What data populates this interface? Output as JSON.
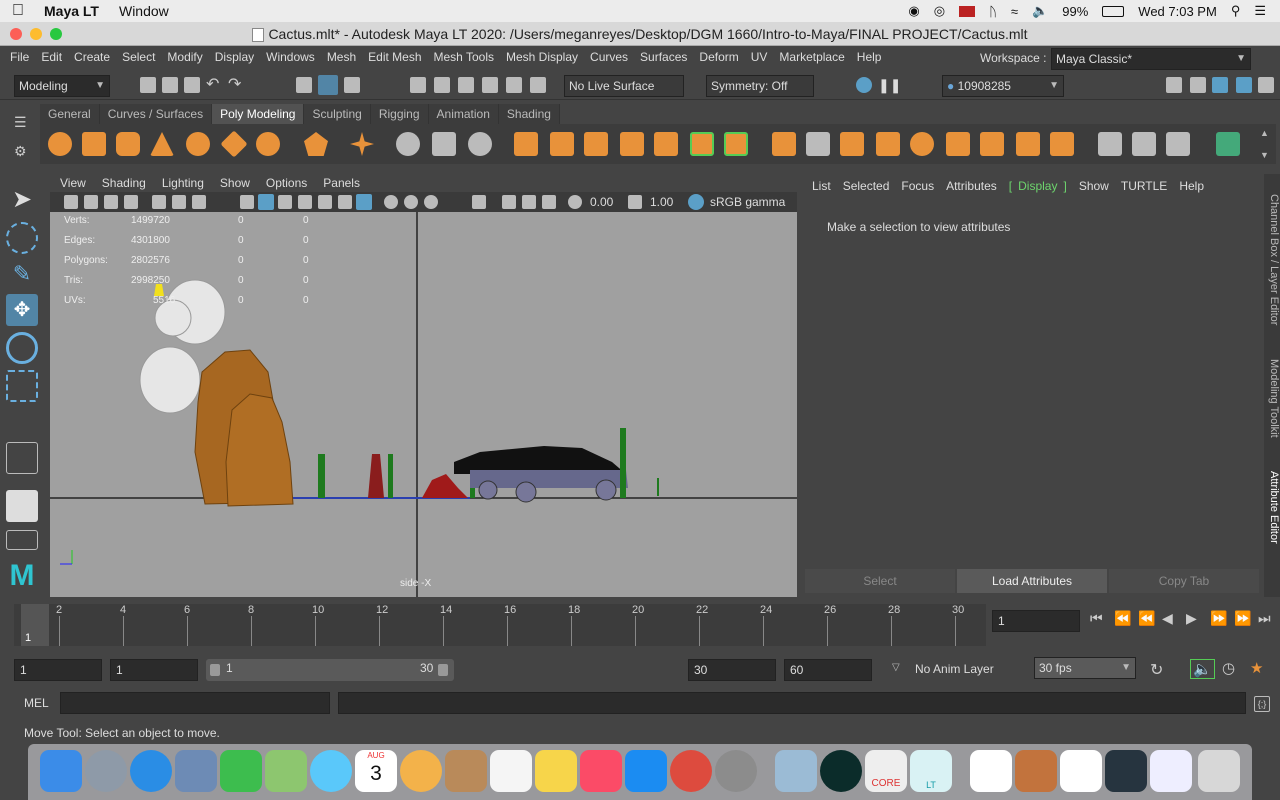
{
  "mac_menubar": {
    "app_name": "Maya LT",
    "window_menu": "Window",
    "battery": "99%",
    "clock": "Wed 7:03 PM"
  },
  "window": {
    "title": "Cactus.mlt* - Autodesk Maya LT 2020: /Users/meganreyes/Desktop/DGM 1660/Intro-to-Maya/FINAL PROJECT/Cactus.mlt"
  },
  "menus": [
    "File",
    "Edit",
    "Create",
    "Select",
    "Modify",
    "Display",
    "Windows",
    "Mesh",
    "Edit Mesh",
    "Mesh Tools",
    "Mesh Display",
    "Curves",
    "Surfaces",
    "Deform",
    "UV",
    "Marketplace",
    "Help"
  ],
  "workspace": {
    "label": "Workspace :",
    "value": "Maya Classic*"
  },
  "statusline": {
    "menuset": "Modeling",
    "live_surface": "No Live Surface",
    "symmetry": "Symmetry: Off",
    "user_id": "10908285"
  },
  "shelf_tabs": [
    "General",
    "Curves / Surfaces",
    "Poly Modeling",
    "Sculpting",
    "Rigging",
    "Animation",
    "Shading"
  ],
  "shelf_active": "Poly Modeling",
  "panel_menu": [
    "View",
    "Shading",
    "Lighting",
    "Show",
    "Options",
    "Panels"
  ],
  "panel_toolbar": {
    "exposure": "0.00",
    "gamma": "1.00",
    "color_space": "sRGB gamma"
  },
  "hud": {
    "rows": [
      {
        "label": "Verts:",
        "a": "1499720",
        "b": "0",
        "c": "0"
      },
      {
        "label": "Edges:",
        "a": "4301800",
        "b": "0",
        "c": "0"
      },
      {
        "label": "Polygons:",
        "a": "2802576",
        "b": "0",
        "c": "0"
      },
      {
        "label": "Tris:",
        "a": "2998250",
        "b": "0",
        "c": "0"
      },
      {
        "label": "UVs:",
        "a": "5516",
        "b": "0",
        "c": "0"
      }
    ],
    "camera": "side -X"
  },
  "channel_box": {
    "menu": [
      "List",
      "Selected",
      "Focus",
      "Attributes",
      "Display",
      "Show",
      "TURTLE",
      "Help"
    ],
    "active": "Display",
    "message": "Make a selection to view attributes",
    "buttons": [
      "Select",
      "Load Attributes",
      "Copy Tab"
    ]
  },
  "side_tabs": [
    "Channel Box / Layer Editor",
    "Modeling Toolkit",
    "Attribute Editor"
  ],
  "timeline": {
    "ticks": [
      "2",
      "4",
      "6",
      "8",
      "10",
      "12",
      "14",
      "16",
      "18",
      "20",
      "22",
      "24",
      "26",
      "28",
      "30"
    ],
    "current_marker": "1",
    "current_frame": "1"
  },
  "range": {
    "start": "1",
    "playback_start": "1",
    "slider_start": "1",
    "slider_end": "30",
    "playback_end": "30",
    "end": "60",
    "anim_layer": "No Anim Layer",
    "fps": "30 fps"
  },
  "command_line": {
    "label": "MEL",
    "value": ""
  },
  "help_line": "Move Tool: Select an object to move.",
  "dock": {
    "calendar_month": "AUG",
    "calendar_day": "3",
    "core_label": "CORE",
    "lt_label": "LT"
  }
}
